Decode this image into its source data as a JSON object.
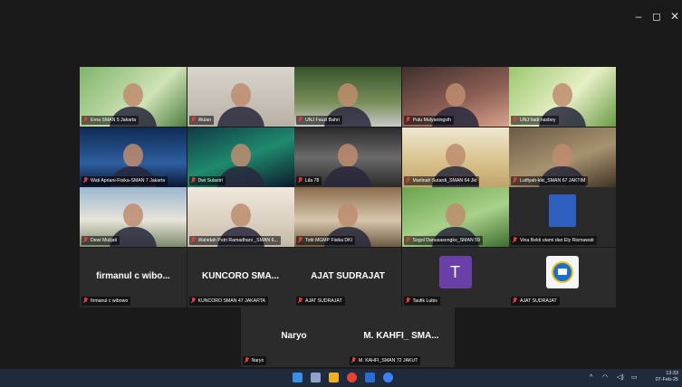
{
  "window": {
    "controls": {
      "minimize": "–",
      "maximize": "◻",
      "close": "✕"
    }
  },
  "participants": [
    {
      "name": "Erna SMAN 5 Jakarta",
      "video": true
    },
    {
      "name": "Wulan",
      "video": true
    },
    {
      "name": "UNJ Fauzi Bahri",
      "video": true
    },
    {
      "name": "Putu Mulyaningsih",
      "video": true
    },
    {
      "name": "UNJ hadi nasbey",
      "video": true
    },
    {
      "name": "Wati Apriani-Fisika-SMAN 7 Jakarta",
      "video": true
    },
    {
      "name": "Dwi Sulastri",
      "video": true,
      "active": true
    },
    {
      "name": "Lila 78",
      "video": true
    },
    {
      "name": "Marlinah Sutardi_SMAN 64 Jkt",
      "video": true
    },
    {
      "name": "Lutfiyah-kiki_SMAN 67 JAKTIM",
      "video": true
    },
    {
      "name": "Dewi Mulijati",
      "video": true
    },
    {
      "name": "Wahidah Putri Ramadhani _SMAN 6...",
      "video": true
    },
    {
      "name": "Totti MGMP Fisika DKI",
      "video": true
    },
    {
      "name": "Sogol Danusasongko_SMAN 59",
      "video": true
    },
    {
      "name": "Vina Bekti utami dan Ely Rismawati",
      "video": true
    },
    {
      "name": "firmanul c wibowo",
      "display": "firmanul c wibo...",
      "video": false
    },
    {
      "name": "KUNCORO SMAN 47 JAKARTA",
      "display": "KUNCORO SMA...",
      "video": false
    },
    {
      "name": "AJAT SUDRAJAT",
      "display": "AJAT SUDRAJAT",
      "video": false
    },
    {
      "name": "Taufik Lubis",
      "avatar_letter": "T",
      "video": false
    },
    {
      "name": "AJAT SUDRAJAT",
      "logo": true,
      "video": false
    },
    {
      "name": "Naryo",
      "display": "Naryo",
      "video": false
    },
    {
      "name": "M. KAHFI_SMAN 72 JAKUT",
      "display": "M. KAHFI_ SMA...",
      "video": false
    }
  ],
  "taskbar": {
    "tray": {
      "chevron": "^",
      "wifi": "◠",
      "volume": "◁)",
      "battery": "▭"
    },
    "time": "13:33",
    "date": "07-Feb-25"
  },
  "colors": {
    "accent_active": "#2fc45a",
    "muted_mic": "#e23b3b",
    "avatar_purple": "#6b3fa8"
  }
}
